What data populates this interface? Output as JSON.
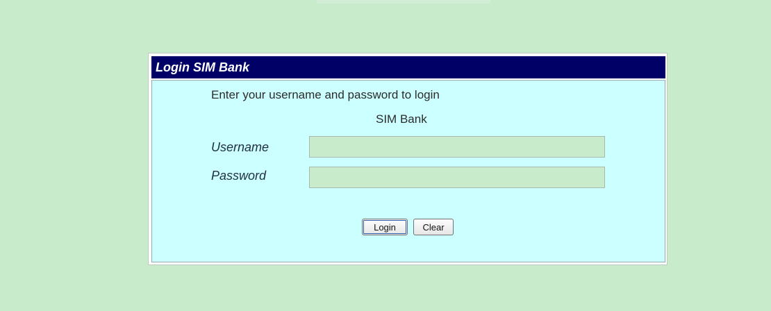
{
  "panel": {
    "title": "Login SIM Bank"
  },
  "form": {
    "instruction": "Enter your username and password to login",
    "subtitle": "SIM Bank",
    "username_label": "Username",
    "username_value": "",
    "password_label": "Password",
    "password_value": ""
  },
  "buttons": {
    "login_label": "Login",
    "clear_label": "Clear"
  },
  "colors": {
    "page_background": "#c8ebcb",
    "header_background": "#000066",
    "form_background": "#ccffff",
    "input_background": "#c8ebcb"
  }
}
